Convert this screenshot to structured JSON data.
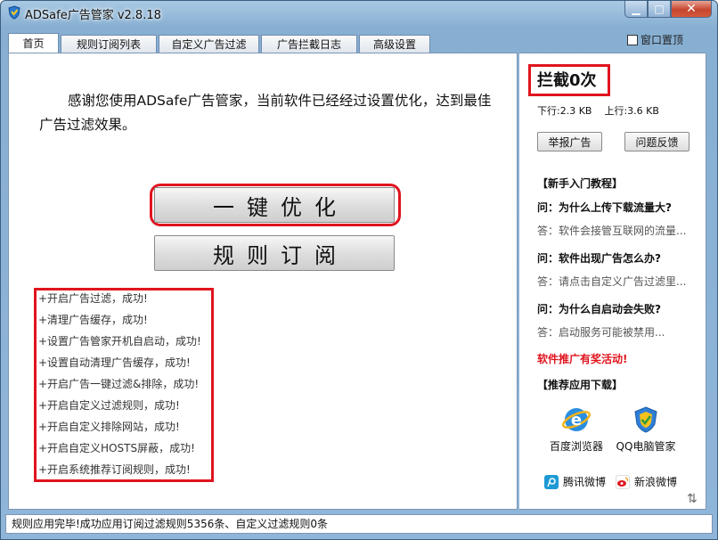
{
  "window": {
    "title": "ADSafe广告管家 v2.8.18",
    "minimize_glyph": "▁",
    "maximize_glyph": "□",
    "close_glyph": "✕"
  },
  "tabs": [
    {
      "label": "首页",
      "active": true
    },
    {
      "label": "规则订阅列表",
      "active": false
    },
    {
      "label": "自定义广告过滤",
      "active": false
    },
    {
      "label": "广告拦截日志",
      "active": false
    },
    {
      "label": "高级设置",
      "active": false
    }
  ],
  "topmost_label": "窗口置顶",
  "main": {
    "welcome": "感谢您使用ADSafe广告管家，当前软件已经经过设置优化，达到最佳广告过滤效果。",
    "optimize_button": "一键优化",
    "subscribe_button": "规则订阅",
    "log": [
      "+开启广告过滤，成功!",
      "+清理广告缓存，成功!",
      "+设置广告管家开机自启动，成功!",
      "+设置自动清理广告缓存，成功!",
      "+开启广告一键过滤&排除，成功!",
      "+开启自定义过滤规则，成功!",
      "+开启自定义排除网站，成功!",
      "+开启自定义HOSTS屏蔽，成功!",
      "+开启系统推荐订阅规则，成功!"
    ]
  },
  "side": {
    "block_count": "拦截0次",
    "download": "下行:2.3 KB",
    "upload": "上行:3.6 KB",
    "report_button": "举报广告",
    "feedback_button": "问题反馈",
    "tutorial_title": "【新手入门教程】",
    "qa": [
      {
        "q": "问：为什么上传下载流量大?",
        "a": "答：软件会接管互联网的流量..."
      },
      {
        "q": "问：软件出现广告怎么办?",
        "a": "答：请点击自定义广告过滤里..."
      },
      {
        "q": "问：为什么自启动会失败?",
        "a": "答：启动服务可能被禁用..."
      }
    ],
    "promo": "软件推广有奖活动!",
    "apps_title": "【推荐应用下载】",
    "apps": [
      {
        "label": "百度浏览器",
        "icon": "baidu-browser-icon"
      },
      {
        "label": "QQ电脑管家",
        "icon": "qq-pc-manager-icon"
      }
    ],
    "weibo": [
      {
        "label": "腾讯微博",
        "icon": "tencent-weibo-icon"
      },
      {
        "label": "新浪微博",
        "icon": "sina-weibo-icon"
      }
    ]
  },
  "status": "规则应用完毕!成功应用订阅过滤规则5356条、自定义过滤规则0条",
  "colors": {
    "highlight": "#e0141e",
    "promo": "#e0141e"
  }
}
